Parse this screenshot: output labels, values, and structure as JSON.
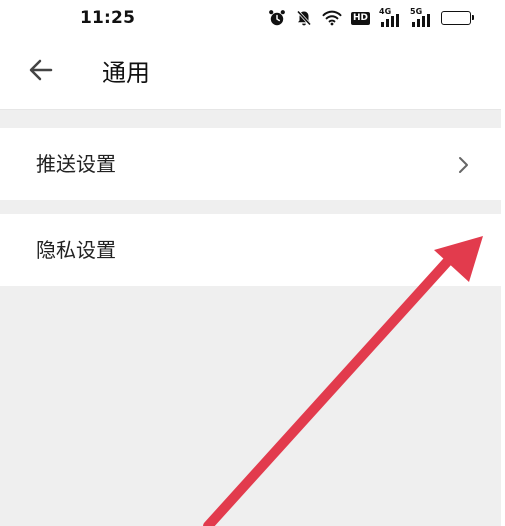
{
  "status_bar": {
    "time": "11:25",
    "icons": [
      "alarm-icon",
      "mute-icon",
      "wifi-icon",
      "hd-icon",
      "signal-4g-icon",
      "signal-5g-icon",
      "battery-icon"
    ],
    "hd_label": "HD",
    "network_1": "4G",
    "network_2": "5G",
    "battery_color": "#f3c12a"
  },
  "header": {
    "back_icon": "arrow-left-icon",
    "title": "通用"
  },
  "settings": {
    "items": [
      {
        "label": "推送设置",
        "icon": "chevron-right-icon"
      },
      {
        "label": "隐私设置",
        "icon": "chevron-right-icon"
      }
    ]
  },
  "colors": {
    "background": "#efefef",
    "surface": "#ffffff",
    "text": "#222222",
    "annotation": "#e23b4d"
  }
}
